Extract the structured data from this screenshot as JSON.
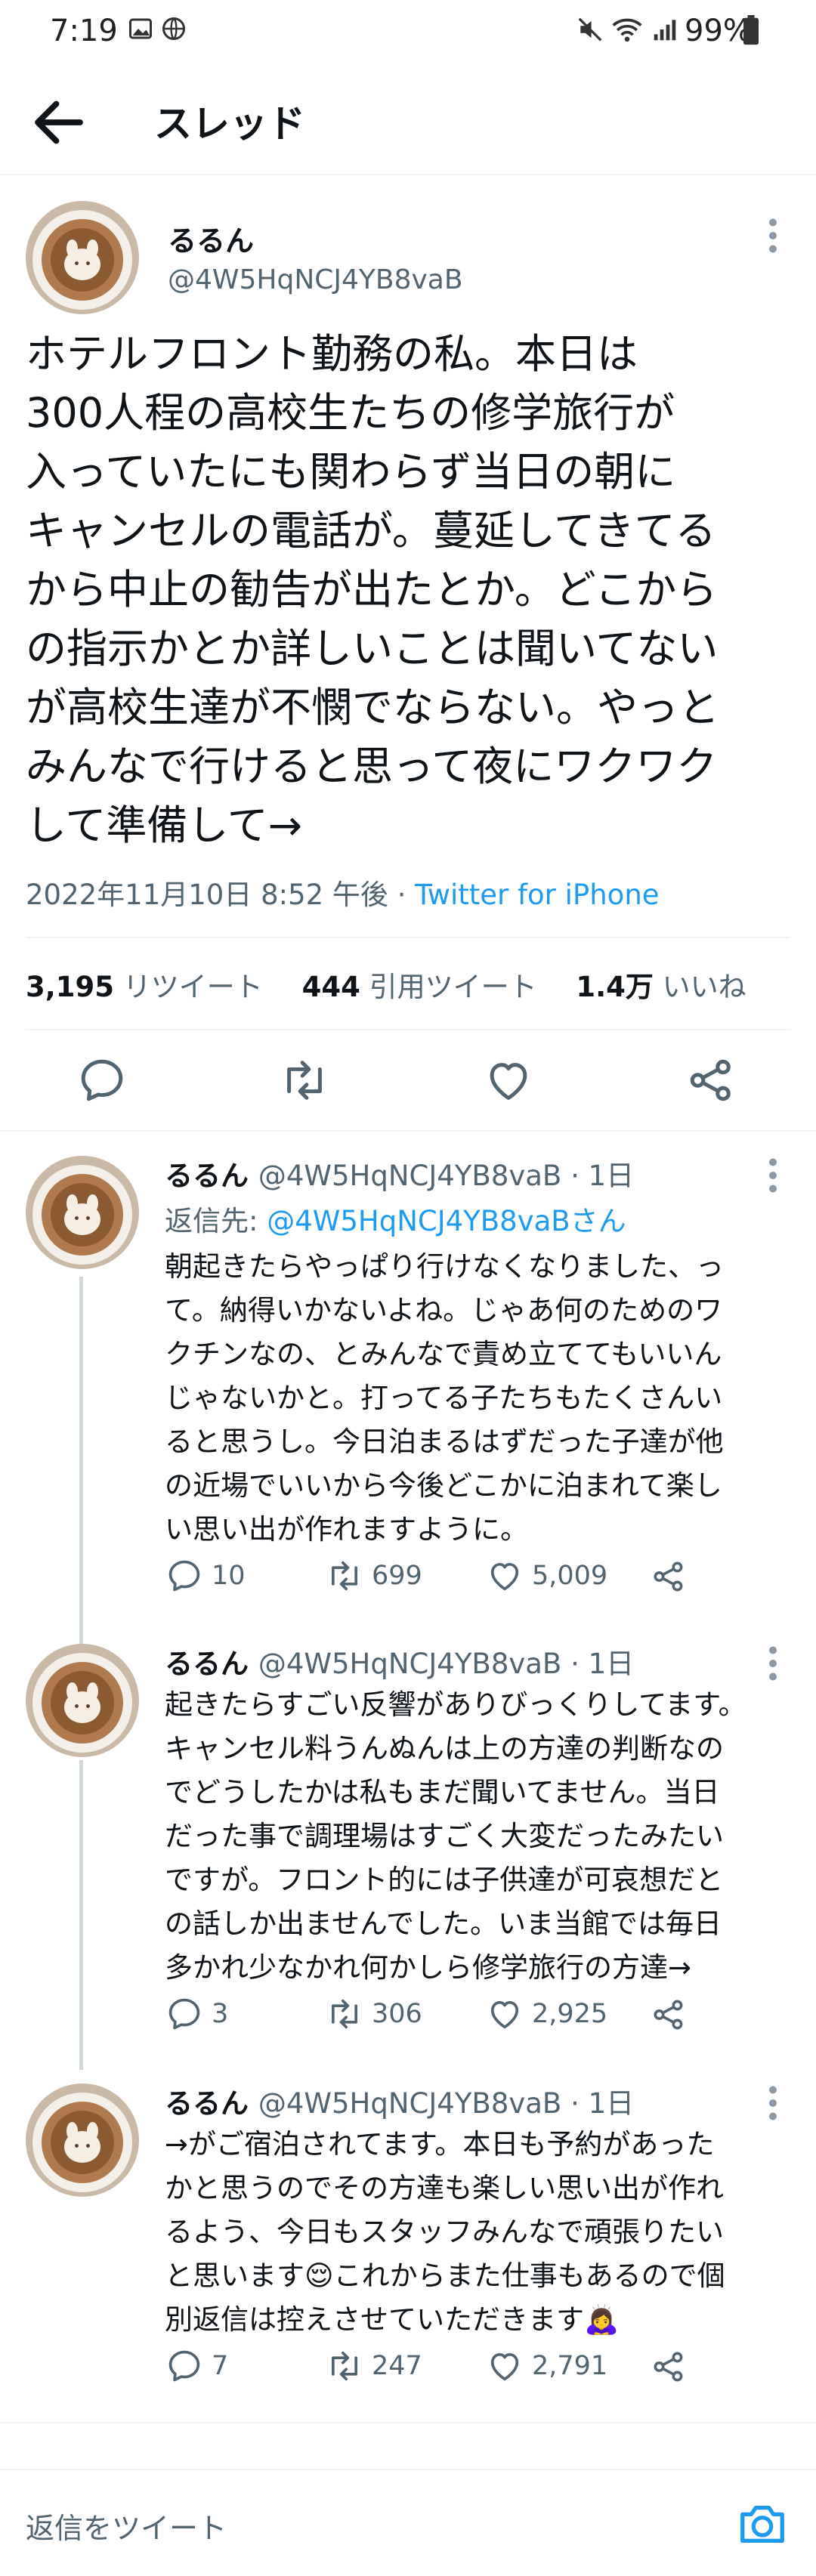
{
  "status_bar": {
    "time": "7:19",
    "battery": "99%"
  },
  "header": {
    "title": "スレッド"
  },
  "main_tweet": {
    "name": "るるん",
    "handle": "@4W5HqNCJ4YB8vaB",
    "text": "ホテルフロント勤務の私。本日は\n300人程の高校生たちの修学旅行が\n入っていたにも関わらず当日の朝に\nキャンセルの電話が。蔓延してきてる\nから中止の勧告が出たとか。どこから\nの指示かとか詳しいことは聞いてない\nが高校生達が不憫でならない。やっと\nみんなで行けると思って夜にワクワク\nして準備して→",
    "timestamp": "2022年11月10日 8:52 午後",
    "source": "Twitter for iPhone",
    "retweets": "3,195",
    "retweets_label": "リツイート",
    "quotes": "444",
    "quotes_label": "引用ツイート",
    "likes": "1.4万",
    "likes_label": "いいね"
  },
  "replies": [
    {
      "name": "るるん",
      "handle_time": "@4W5HqNCJ4YB8vaB · 1日",
      "reply_to_label": "返信先:",
      "reply_to_handle": "@4W5HqNCJ4YB8vaBさん",
      "text": "朝起きたらやっぱり行けなくなりました、っ\nて。納得いかないよね。じゃあ何のためのワ\nクチンなの、とみんなで責め立ててもいいん\nじゃないかと。打ってる子たちもたくさんい\nると思うし。今日泊まるはずだった子達が他\nの近場でいいから今後どこかに泊まれて楽し\nい思い出が作れますように。",
      "replies": "10",
      "retweets": "699",
      "likes": "5,009"
    },
    {
      "name": "るるん",
      "handle_time": "@4W5HqNCJ4YB8vaB · 1日",
      "text": "起きたらすごい反響がありびっくりしてます。\nキャンセル料うんぬんは上の方達の判断なの\nでどうしたかは私もまだ聞いてません。当日\nだった事で調理場はすごく大変だったみたい\nですが。フロント的には子供達が可哀想だと\nの話しか出ませんでした。いま当館では毎日\n多かれ少なかれ何かしら修学旅行の方達→",
      "replies": "3",
      "retweets": "306",
      "likes": "2,925"
    },
    {
      "name": "るるん",
      "handle_time": "@4W5HqNCJ4YB8vaB · 1日",
      "text": "→がご宿泊されてます。本日も予約があった\nかと思うのでその方達も楽しい思い出が作れ\nるよう、今日もスタッフみんなで頑張りたい\nと思います😌これからまた仕事もあるので個\n別返信は控えさせていただきます🙇‍♀️",
      "replies": "7",
      "retweets": "247",
      "likes": "2,791"
    }
  ],
  "composer": {
    "placeholder": "返信をツイート"
  },
  "icons": [
    "back-arrow-icon",
    "more-icon",
    "reply-icon",
    "retweet-icon",
    "like-icon",
    "share-icon",
    "camera-icon",
    "mute-icon",
    "wifi-icon",
    "signal-icon",
    "battery-icon"
  ],
  "colors": {
    "accent": "#1d9bf0",
    "secondary_text": "#536471"
  }
}
